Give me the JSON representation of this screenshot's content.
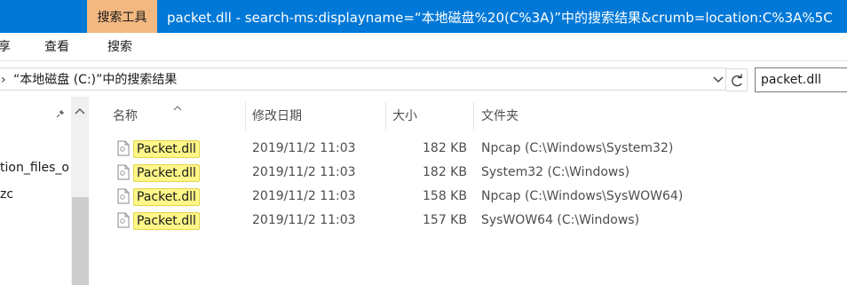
{
  "titlebar": {
    "context_tab": "搜索工具",
    "title": "packet.dll - search-ms:displayname=“本地磁盘%20(C%3A)”中的搜索结果&crumb=location:C%3A%5C"
  },
  "ribbon": {
    "tabs": [
      "享",
      "查看",
      "搜索"
    ]
  },
  "address": {
    "path": "“本地磁盘 (C:)”中的搜索结果",
    "search_value": "packet.dll"
  },
  "nav": {
    "items": [
      "tion_files_o",
      "zc"
    ]
  },
  "list": {
    "columns": [
      "名称",
      "修改日期",
      "大小",
      "文件夹"
    ],
    "rows": [
      {
        "name": "Packet.dll",
        "date": "2019/11/2 11:03",
        "size": "182 KB",
        "folder": "Npcap (C:\\Windows\\System32)"
      },
      {
        "name": "Packet.dll",
        "date": "2019/11/2 11:03",
        "size": "182 KB",
        "folder": "System32 (C:\\Windows)"
      },
      {
        "name": "Packet.dll",
        "date": "2019/11/2 11:03",
        "size": "158 KB",
        "folder": "Npcap (C:\\Windows\\SysWOW64)"
      },
      {
        "name": "Packet.dll",
        "date": "2019/11/2 11:03",
        "size": "157 KB",
        "folder": "SysWOW64 (C:\\Windows)"
      }
    ]
  },
  "icons": {
    "file": "dll-file-icon",
    "pin": "pin-icon",
    "refresh": "refresh-icon",
    "dropdown": "chevron-down-icon",
    "sort": "sort-up-icon"
  },
  "colors": {
    "titlebar": "#0078d7",
    "context_tab": "#f2b880",
    "highlight": "#fff788"
  }
}
